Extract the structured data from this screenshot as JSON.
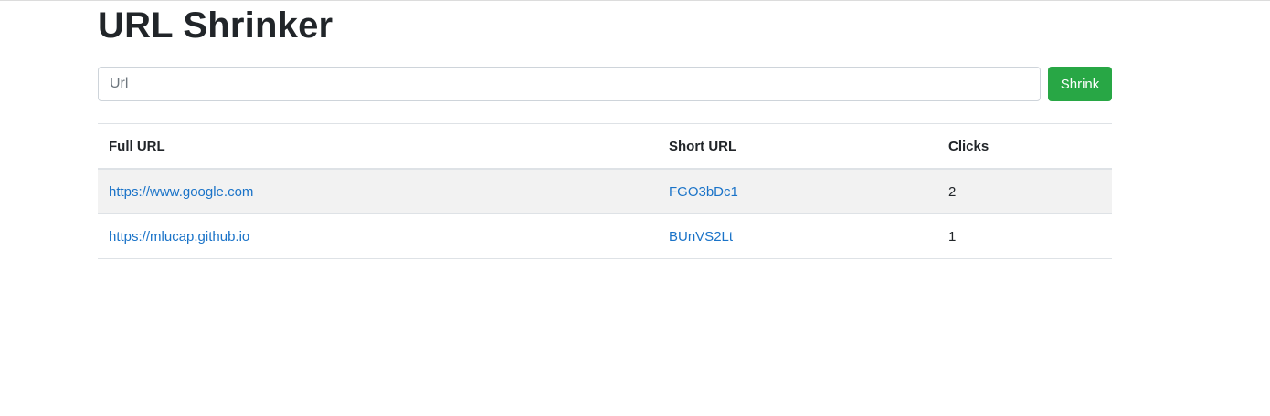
{
  "page": {
    "title": "URL Shrinker"
  },
  "form": {
    "url_placeholder": "Url",
    "url_value": "",
    "shrink_label": "Shrink"
  },
  "table": {
    "headers": [
      "Full URL",
      "Short URL",
      "Clicks"
    ],
    "rows": [
      {
        "full": "https://www.google.com",
        "short": "FGO3bDc1",
        "clicks": "2"
      },
      {
        "full": "https://mlucap.github.io",
        "short": "BUnVS2Lt",
        "clicks": "1"
      }
    ]
  },
  "colors": {
    "button_bg": "#28a745",
    "link": "#1a73c8",
    "stripe": "#f2f2f2"
  }
}
